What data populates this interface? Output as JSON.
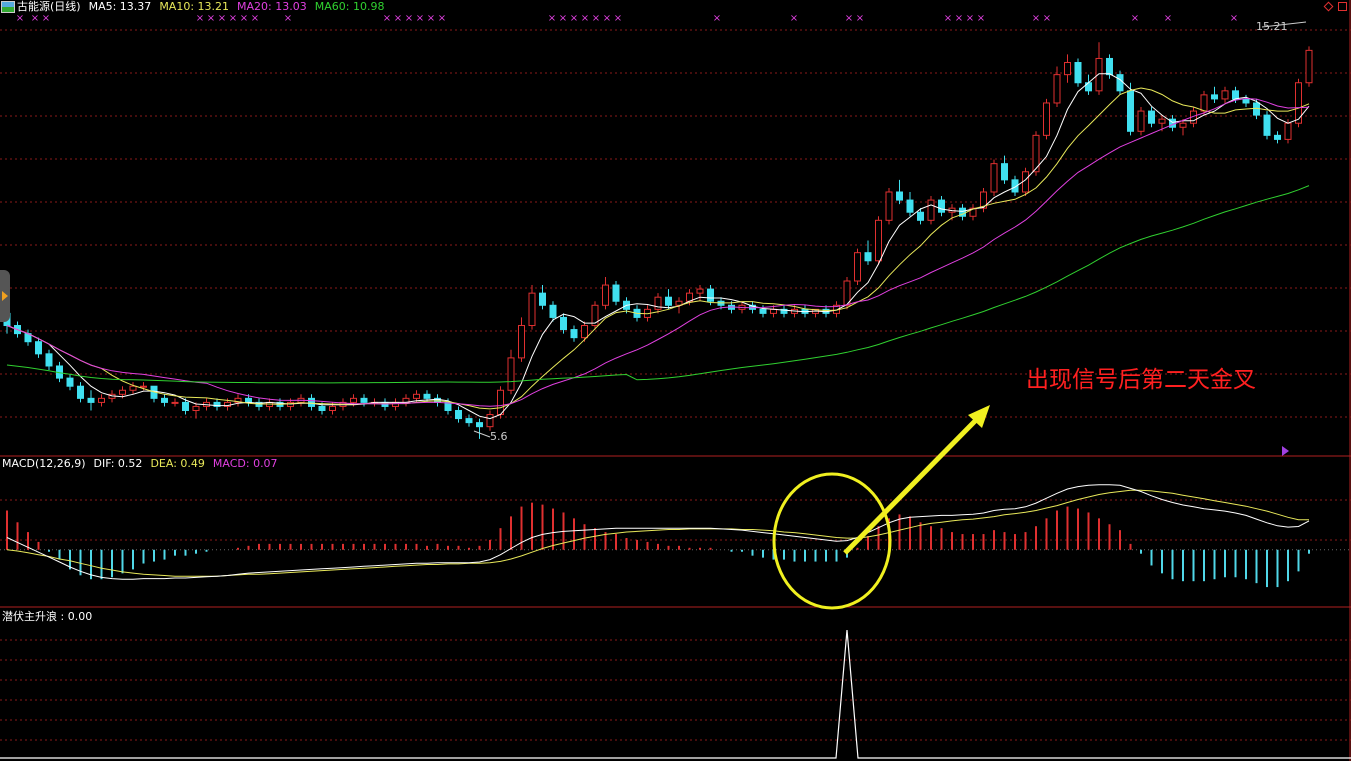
{
  "header": {
    "stock_title": "古能源(日线)",
    "ma5": "MA5: 13.37",
    "ma10": "MA10: 13.21",
    "ma20": "MA20: 13.03",
    "ma60": "MA60: 10.98"
  },
  "macd_header": {
    "label": "MACD(12,26,9)",
    "dif": "DIF: 0.52",
    "dea": "DEA: 0.49",
    "macd": "MACD: 0.07"
  },
  "indicator_header": {
    "label": "潜伏主升浪 : 0.00"
  },
  "annotation": {
    "text": "出现信号后第二天金叉"
  },
  "colors": {
    "up": "#e03030",
    "down": "#40e0f0",
    "ma5": "#ffffff",
    "ma10": "#e8e85a",
    "ma20": "#e040e0",
    "ma60": "#30d030",
    "dif": "#ffffff",
    "dea": "#e8e85a",
    "grid": "#8a1a1a",
    "annotation": "#ff2020",
    "highlight": "#f0f020"
  },
  "chart_data": [
    {
      "type": "candlestick",
      "title": "古能源(日线)",
      "ylim": [
        5.2,
        16.0
      ],
      "markers": {
        "high": 15.21,
        "low": 5.6
      },
      "ohlc": [
        [
          8.7,
          8.8,
          8.2,
          8.4
        ],
        [
          8.4,
          8.5,
          8.1,
          8.2
        ],
        [
          8.2,
          8.3,
          7.9,
          8.0
        ],
        [
          8.0,
          8.1,
          7.6,
          7.7
        ],
        [
          7.7,
          7.8,
          7.3,
          7.4
        ],
        [
          7.4,
          7.5,
          7.0,
          7.1
        ],
        [
          7.1,
          7.2,
          6.8,
          6.9
        ],
        [
          6.9,
          7.0,
          6.5,
          6.6
        ],
        [
          6.6,
          6.8,
          6.3,
          6.5
        ],
        [
          6.5,
          6.7,
          6.4,
          6.6
        ],
        [
          6.6,
          6.8,
          6.5,
          6.7
        ],
        [
          6.7,
          6.9,
          6.6,
          6.8
        ],
        [
          6.8,
          7.0,
          6.7,
          6.9
        ],
        [
          6.9,
          7.0,
          6.8,
          6.9
        ],
        [
          6.9,
          6.9,
          6.5,
          6.6
        ],
        [
          6.6,
          6.7,
          6.4,
          6.5
        ],
        [
          6.5,
          6.6,
          6.4,
          6.5
        ],
        [
          6.5,
          6.6,
          6.2,
          6.3
        ],
        [
          6.3,
          6.5,
          6.1,
          6.4
        ],
        [
          6.4,
          6.6,
          6.3,
          6.5
        ],
        [
          6.5,
          6.6,
          6.3,
          6.4
        ],
        [
          6.4,
          6.6,
          6.3,
          6.5
        ],
        [
          6.5,
          6.7,
          6.4,
          6.6
        ],
        [
          6.6,
          6.7,
          6.4,
          6.5
        ],
        [
          6.5,
          6.6,
          6.3,
          6.4
        ],
        [
          6.4,
          6.6,
          6.3,
          6.5
        ],
        [
          6.5,
          6.6,
          6.3,
          6.4
        ],
        [
          6.4,
          6.6,
          6.3,
          6.5
        ],
        [
          6.5,
          6.7,
          6.4,
          6.6
        ],
        [
          6.6,
          6.7,
          6.3,
          6.4
        ],
        [
          6.4,
          6.5,
          6.2,
          6.3
        ],
        [
          6.3,
          6.5,
          6.2,
          6.4
        ],
        [
          6.4,
          6.6,
          6.3,
          6.5
        ],
        [
          6.5,
          6.7,
          6.4,
          6.6
        ],
        [
          6.6,
          6.7,
          6.4,
          6.5
        ],
        [
          6.5,
          6.6,
          6.4,
          6.5
        ],
        [
          6.5,
          6.6,
          6.3,
          6.4
        ],
        [
          6.4,
          6.6,
          6.3,
          6.5
        ],
        [
          6.5,
          6.7,
          6.4,
          6.6
        ],
        [
          6.6,
          6.8,
          6.5,
          6.7
        ],
        [
          6.7,
          6.8,
          6.5,
          6.6
        ],
        [
          6.6,
          6.7,
          6.4,
          6.5
        ],
        [
          6.5,
          6.6,
          6.2,
          6.3
        ],
        [
          6.3,
          6.4,
          6.0,
          6.1
        ],
        [
          6.1,
          6.2,
          5.9,
          6.0
        ],
        [
          6.0,
          6.1,
          5.6,
          5.9
        ],
        [
          5.9,
          6.3,
          5.8,
          6.2
        ],
        [
          6.2,
          6.9,
          6.1,
          6.8
        ],
        [
          6.8,
          7.8,
          6.7,
          7.6
        ],
        [
          7.6,
          8.6,
          7.5,
          8.4
        ],
        [
          8.4,
          9.4,
          8.3,
          9.2
        ],
        [
          9.2,
          9.4,
          8.8,
          8.9
        ],
        [
          8.9,
          9.0,
          8.5,
          8.6
        ],
        [
          8.6,
          8.7,
          8.2,
          8.3
        ],
        [
          8.3,
          8.4,
          8.0,
          8.1
        ],
        [
          8.1,
          8.5,
          8.0,
          8.4
        ],
        [
          8.4,
          9.0,
          8.3,
          8.9
        ],
        [
          8.9,
          9.6,
          8.8,
          9.4
        ],
        [
          9.4,
          9.5,
          8.9,
          9.0
        ],
        [
          9.0,
          9.1,
          8.7,
          8.8
        ],
        [
          8.8,
          8.9,
          8.5,
          8.6
        ],
        [
          8.6,
          8.9,
          8.5,
          8.8
        ],
        [
          8.8,
          9.2,
          8.7,
          9.1
        ],
        [
          9.1,
          9.3,
          8.8,
          8.9
        ],
        [
          8.9,
          9.1,
          8.7,
          9.0
        ],
        [
          9.0,
          9.3,
          8.9,
          9.2
        ],
        [
          9.2,
          9.4,
          9.0,
          9.3
        ],
        [
          9.3,
          9.4,
          8.9,
          9.0
        ],
        [
          9.0,
          9.1,
          8.8,
          8.9
        ],
        [
          8.9,
          9.0,
          8.7,
          8.8
        ],
        [
          8.8,
          9.0,
          8.7,
          8.9
        ],
        [
          8.9,
          9.0,
          8.7,
          8.8
        ],
        [
          8.8,
          8.9,
          8.6,
          8.7
        ],
        [
          8.7,
          8.9,
          8.6,
          8.8
        ],
        [
          8.8,
          8.9,
          8.6,
          8.7
        ],
        [
          8.7,
          8.9,
          8.6,
          8.8
        ],
        [
          8.8,
          8.9,
          8.6,
          8.7
        ],
        [
          8.7,
          8.8,
          8.6,
          8.8
        ],
        [
          8.8,
          8.9,
          8.6,
          8.7
        ],
        [
          8.7,
          9.0,
          8.6,
          8.9
        ],
        [
          8.9,
          9.6,
          8.8,
          9.5
        ],
        [
          9.5,
          10.3,
          9.4,
          10.2
        ],
        [
          10.2,
          10.5,
          9.9,
          10.0
        ],
        [
          10.0,
          11.1,
          9.9,
          11.0
        ],
        [
          11.0,
          11.8,
          10.9,
          11.7
        ],
        [
          11.7,
          12.0,
          11.4,
          11.5
        ],
        [
          11.5,
          11.7,
          11.1,
          11.2
        ],
        [
          11.2,
          11.3,
          10.9,
          11.0
        ],
        [
          11.0,
          11.6,
          10.9,
          11.5
        ],
        [
          11.5,
          11.6,
          11.1,
          11.2
        ],
        [
          11.2,
          11.4,
          11.0,
          11.3
        ],
        [
          11.3,
          11.4,
          11.0,
          11.1
        ],
        [
          11.1,
          11.4,
          11.0,
          11.3
        ],
        [
          11.3,
          11.8,
          11.2,
          11.7
        ],
        [
          11.7,
          12.5,
          11.6,
          12.4
        ],
        [
          12.4,
          12.6,
          11.9,
          12.0
        ],
        [
          12.0,
          12.1,
          11.6,
          11.7
        ],
        [
          11.7,
          12.3,
          11.6,
          12.2
        ],
        [
          12.2,
          13.2,
          12.1,
          13.1
        ],
        [
          13.1,
          14.0,
          13.0,
          13.9
        ],
        [
          13.9,
          14.8,
          13.8,
          14.6
        ],
        [
          14.6,
          15.1,
          14.4,
          14.9
        ],
        [
          14.9,
          15.0,
          14.3,
          14.4
        ],
        [
          14.4,
          14.6,
          14.1,
          14.2
        ],
        [
          14.2,
          15.4,
          14.1,
          15.0
        ],
        [
          15.0,
          15.1,
          14.5,
          14.6
        ],
        [
          14.6,
          14.7,
          14.1,
          14.2
        ],
        [
          14.2,
          14.4,
          13.1,
          13.2
        ],
        [
          13.2,
          13.8,
          13.1,
          13.7
        ],
        [
          13.7,
          13.8,
          13.3,
          13.4
        ],
        [
          13.4,
          13.6,
          13.2,
          13.5
        ],
        [
          13.5,
          13.6,
          13.2,
          13.3
        ],
        [
          13.3,
          13.5,
          13.1,
          13.4
        ],
        [
          13.4,
          13.8,
          13.3,
          13.7
        ],
        [
          13.7,
          14.2,
          13.6,
          14.1
        ],
        [
          14.1,
          14.3,
          13.9,
          14.0
        ],
        [
          14.0,
          14.3,
          13.9,
          14.2
        ],
        [
          14.2,
          14.3,
          13.9,
          14.0
        ],
        [
          14.0,
          14.1,
          13.8,
          13.9
        ],
        [
          13.9,
          14.0,
          13.5,
          13.6
        ],
        [
          13.6,
          13.7,
          13.0,
          13.1
        ],
        [
          13.1,
          13.2,
          12.9,
          13.0
        ],
        [
          13.0,
          13.5,
          12.9,
          13.4
        ],
        [
          13.4,
          14.5,
          13.3,
          14.4
        ],
        [
          14.4,
          15.3,
          14.3,
          15.2
        ]
      ]
    },
    {
      "type": "macd",
      "title": "MACD(12,26,9)",
      "ylim": [
        -0.9,
        1.3
      ],
      "dif": [
        0.2,
        0.12,
        0.04,
        -0.04,
        -0.12,
        -0.2,
        -0.28,
        -0.35,
        -0.41,
        -0.45,
        -0.47,
        -0.48,
        -0.48,
        -0.47,
        -0.47,
        -0.47,
        -0.46,
        -0.46,
        -0.45,
        -0.44,
        -0.43,
        -0.42,
        -0.4,
        -0.38,
        -0.37,
        -0.36,
        -0.35,
        -0.34,
        -0.33,
        -0.32,
        -0.31,
        -0.3,
        -0.29,
        -0.28,
        -0.27,
        -0.26,
        -0.25,
        -0.24,
        -0.23,
        -0.22,
        -0.22,
        -0.21,
        -0.21,
        -0.21,
        -0.21,
        -0.2,
        -0.16,
        -0.08,
        0.02,
        0.12,
        0.2,
        0.25,
        0.28,
        0.3,
        0.31,
        0.32,
        0.33,
        0.34,
        0.35,
        0.35,
        0.35,
        0.35,
        0.35,
        0.35,
        0.35,
        0.35,
        0.35,
        0.35,
        0.34,
        0.33,
        0.32,
        0.3,
        0.28,
        0.26,
        0.24,
        0.22,
        0.2,
        0.18,
        0.16,
        0.14,
        0.15,
        0.2,
        0.28,
        0.36,
        0.44,
        0.5,
        0.53,
        0.54,
        0.55,
        0.56,
        0.56,
        0.57,
        0.58,
        0.6,
        0.64,
        0.66,
        0.67,
        0.7,
        0.76,
        0.84,
        0.92,
        0.99,
        1.03,
        1.05,
        1.06,
        1.06,
        1.05,
        1.0,
        0.95,
        0.88,
        0.82,
        0.77,
        0.73,
        0.7,
        0.67,
        0.65,
        0.63,
        0.6,
        0.56,
        0.5,
        0.44,
        0.39,
        0.37,
        0.38,
        0.47
      ],
      "dea": [
        0.0,
        -0.02,
        -0.05,
        -0.08,
        -0.11,
        -0.15,
        -0.18,
        -0.22,
        -0.26,
        -0.3,
        -0.33,
        -0.36,
        -0.38,
        -0.4,
        -0.41,
        -0.42,
        -0.43,
        -0.43,
        -0.43,
        -0.43,
        -0.43,
        -0.42,
        -0.41,
        -0.4,
        -0.4,
        -0.39,
        -0.38,
        -0.37,
        -0.36,
        -0.35,
        -0.34,
        -0.33,
        -0.32,
        -0.31,
        -0.3,
        -0.29,
        -0.28,
        -0.27,
        -0.26,
        -0.25,
        -0.24,
        -0.24,
        -0.23,
        -0.23,
        -0.22,
        -0.22,
        -0.21,
        -0.19,
        -0.15,
        -0.1,
        -0.04,
        0.02,
        0.07,
        0.11,
        0.15,
        0.19,
        0.22,
        0.25,
        0.27,
        0.29,
        0.3,
        0.31,
        0.32,
        0.33,
        0.33,
        0.34,
        0.34,
        0.34,
        0.34,
        0.34,
        0.33,
        0.33,
        0.32,
        0.31,
        0.29,
        0.28,
        0.26,
        0.24,
        0.22,
        0.2,
        0.19,
        0.19,
        0.21,
        0.24,
        0.28,
        0.32,
        0.36,
        0.4,
        0.43,
        0.45,
        0.47,
        0.49,
        0.5,
        0.52,
        0.54,
        0.57,
        0.59,
        0.61,
        0.64,
        0.68,
        0.72,
        0.77,
        0.82,
        0.86,
        0.9,
        0.93,
        0.95,
        0.97,
        0.97,
        0.96,
        0.94,
        0.92,
        0.89,
        0.86,
        0.83,
        0.8,
        0.77,
        0.74,
        0.71,
        0.67,
        0.63,
        0.58,
        0.53,
        0.49,
        0.49
      ]
    },
    {
      "type": "line",
      "title": "潜伏主升浪",
      "ylim": [
        0,
        1
      ],
      "signal_index": 80,
      "values_note_only_one_spike": true
    }
  ]
}
